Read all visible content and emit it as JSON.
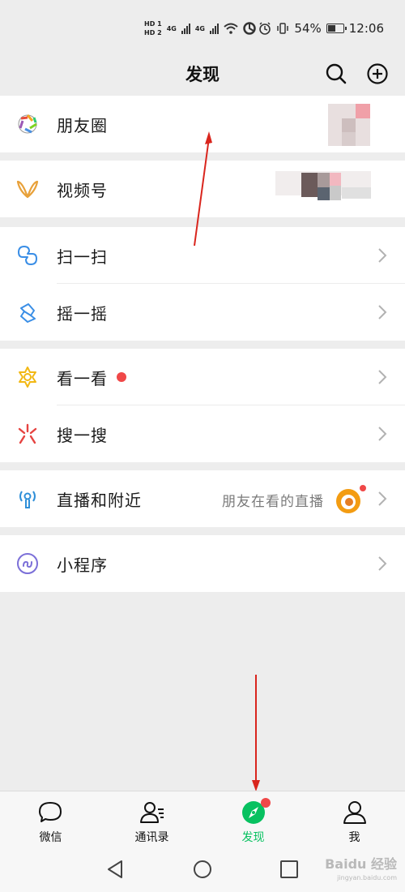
{
  "status_bar": {
    "hd_top": "HD 1",
    "hd_bottom": "HD 2",
    "net_1": "4G",
    "net_2": "4G",
    "battery_percent": "54%",
    "battery_level": 0.54,
    "time": "12:06"
  },
  "header": {
    "title": "发现",
    "icons": [
      "search-icon",
      "add-icon"
    ]
  },
  "menu": {
    "moments": {
      "label": "朋友圈",
      "icon": "moments-aperture-icon"
    },
    "channels": {
      "label": "视频号",
      "icon": "channels-butterfly-icon"
    },
    "scan": {
      "label": "扫一扫",
      "icon": "scan-icon"
    },
    "shake": {
      "label": "摇一摇",
      "icon": "shake-icon"
    },
    "top_stories": {
      "label": "看一看",
      "icon": "top-stories-icon",
      "badge": "red-dot"
    },
    "search": {
      "label": "搜一搜",
      "icon": "search-spark-icon"
    },
    "live_nearby": {
      "label": "直播和附近",
      "subtitle": "朋友在看的直播",
      "icon": "live-nearby-icon"
    },
    "mini_programs": {
      "label": "小程序",
      "icon": "mini-program-icon"
    }
  },
  "tab_bar": {
    "tabs": [
      {
        "label": "微信",
        "icon": "chat-bubble-icon",
        "active": false
      },
      {
        "label": "通讯录",
        "icon": "contacts-icon",
        "active": false
      },
      {
        "label": "发现",
        "icon": "compass-icon",
        "active": true
      },
      {
        "label": "我",
        "icon": "person-icon",
        "active": false
      }
    ]
  },
  "watermark": {
    "brand": "Baidu 经验",
    "url": "jingyan.baidu.com"
  },
  "colors": {
    "accent_green": "#07c160",
    "badge_red": "#f04848",
    "annotation_red": "#d9251d",
    "background": "#ededed"
  }
}
